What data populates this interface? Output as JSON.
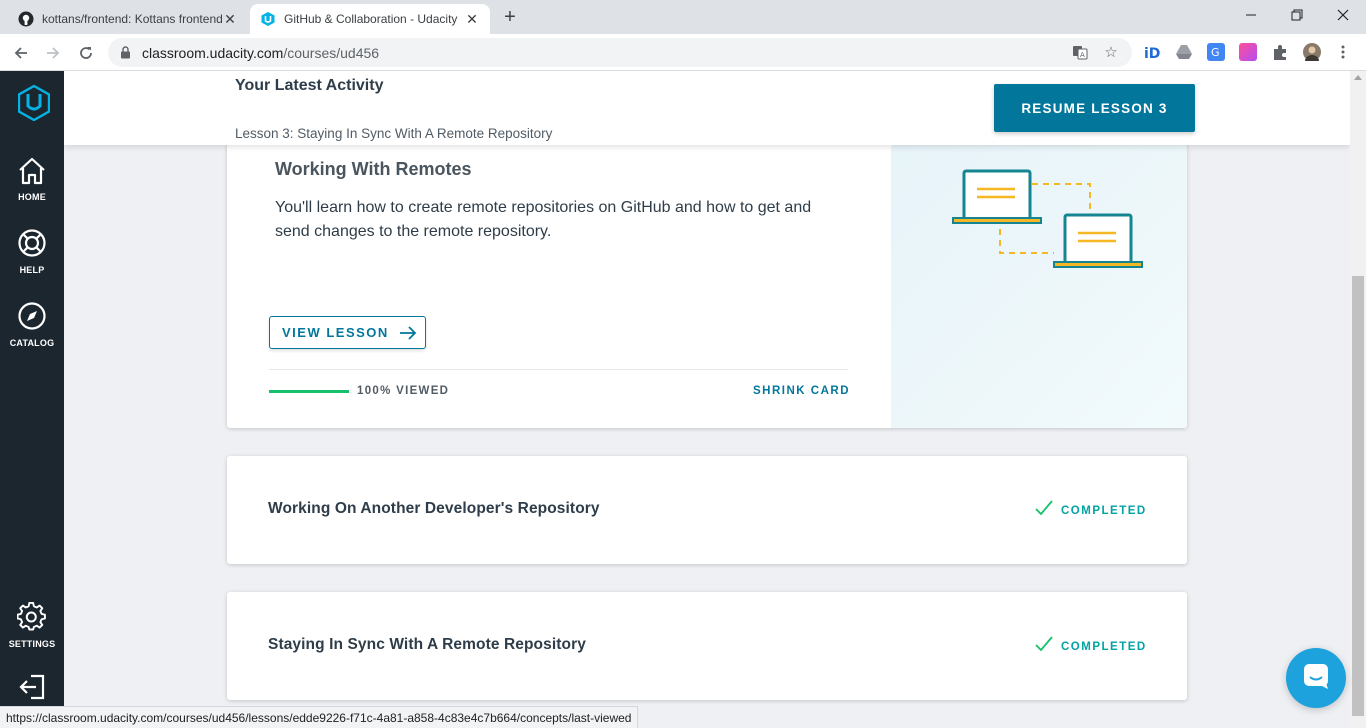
{
  "browser": {
    "tabs": [
      {
        "title": "kottans/frontend: Kottans frontend",
        "active": false
      },
      {
        "title": "GitHub & Collaboration - Udacity",
        "active": true
      }
    ],
    "url_host": "classroom.udacity.com",
    "url_path": "/courses/ud456",
    "status_url": "https://classroom.udacity.com/courses/ud456/lessons/edde9226-f71c-4a81-a858-4c83e4c7b664/concepts/last-viewed"
  },
  "sidebar": {
    "items": [
      {
        "label": "HOME",
        "icon": "home-icon"
      },
      {
        "label": "HELP",
        "icon": "lifebuoy-icon"
      },
      {
        "label": "CATALOG",
        "icon": "compass-icon"
      },
      {
        "label": "SETTINGS",
        "icon": "gear-icon"
      },
      {
        "label": "",
        "icon": "logout-icon"
      }
    ]
  },
  "header": {
    "title": "Your Latest Activity",
    "subtitle": "Lesson 3: Staying In Sync With A Remote Repository",
    "resume_label": "RESUME LESSON 3"
  },
  "lesson_card": {
    "title": "Working With Remotes",
    "description": "You'll learn how to create remote repositories on GitHub and how to get and send changes to the remote repository.",
    "view_label": "VIEW LESSON",
    "progress_fraction": 1.0,
    "progress_label": "100% VIEWED",
    "shrink_label": "SHRINK CARD"
  },
  "lessons": [
    {
      "title": "Working On Another Developer's Repository",
      "status": "COMPLETED"
    },
    {
      "title": "Staying In Sync With A Remote Repository",
      "status": "COMPLETED"
    }
  ],
  "colors": {
    "accent": "#02779b",
    "success": "#15c26b",
    "sidebar": "#1c262f",
    "illustration_teal": "#148591",
    "illustration_yellow": "#f6b724"
  }
}
